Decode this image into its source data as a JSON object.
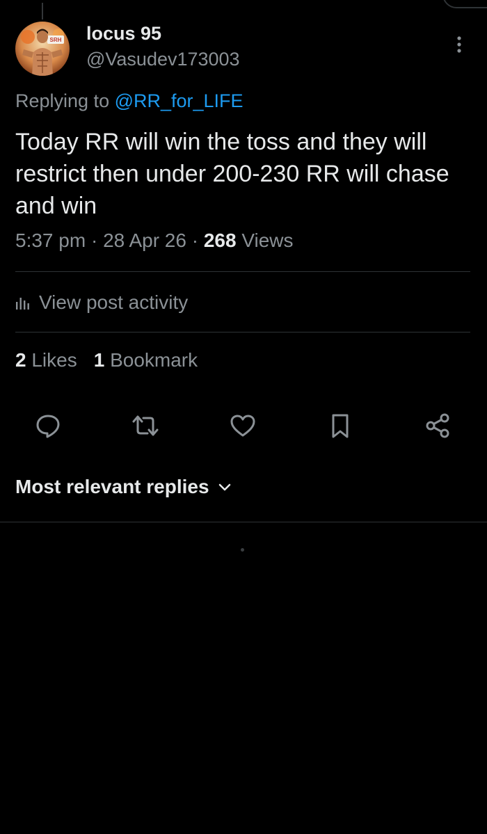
{
  "author": {
    "name": "locus 95",
    "handle": "@Vasudev173003",
    "avatar_badge": "SRH"
  },
  "reply": {
    "prefix": "Replying to ",
    "mention": "@RR_for_LIFE"
  },
  "post": {
    "text": "Today RR will win the toss and they will restrict then under 200-230 RR will chase and win",
    "time": "5:37 pm",
    "date": "28 Apr 26",
    "views_count": "268",
    "views_label": "Views",
    "separator": "·"
  },
  "activity": {
    "label": "View post activity"
  },
  "stats": {
    "likes_count": "2",
    "likes_label": "Likes",
    "bookmarks_count": "1",
    "bookmarks_label": "Bookmark"
  },
  "actions": {
    "icons": [
      "reply-icon",
      "repost-icon",
      "like-icon",
      "bookmark-icon",
      "share-icon"
    ]
  },
  "replies": {
    "sort_label": "Most relevant replies"
  },
  "colors": {
    "background": "#000000",
    "text_primary": "#e7e9ea",
    "text_secondary": "#8b9196",
    "accent": "#1d9bf0",
    "divider": "#2f3336"
  }
}
